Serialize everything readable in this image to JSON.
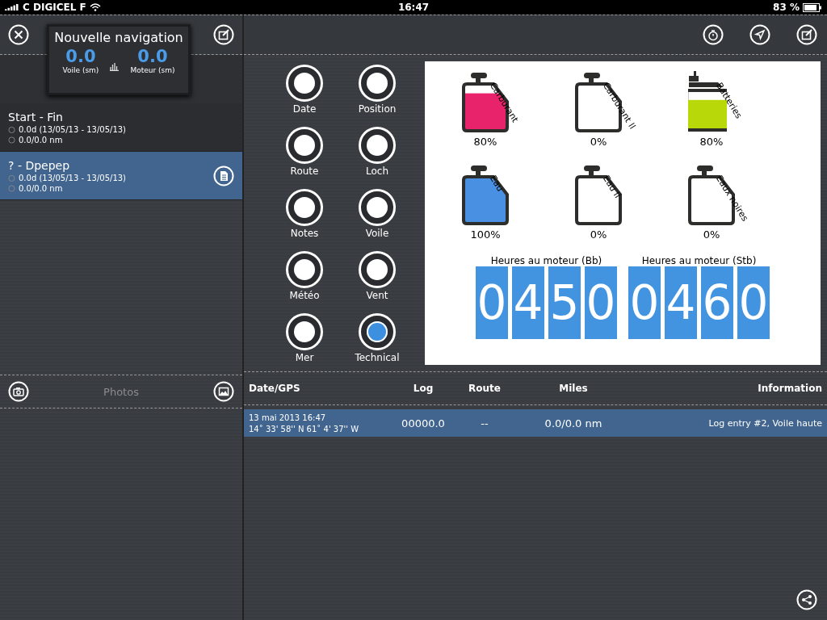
{
  "status_bar": {
    "carrier": "C DIGICEL F",
    "time": "16:47",
    "battery": "83 %"
  },
  "nav_card": {
    "title": "Nouvelle navigation",
    "stats": [
      {
        "value": "0.0",
        "label": "Voile (sm)"
      },
      {
        "value": "0.0",
        "label": "Moteur (sm)"
      }
    ]
  },
  "trips": [
    {
      "title": "Start - Fin",
      "duration": "0.0d (13/05/13 - 13/05/13)",
      "distance": "0.0/0.0 nm",
      "selected": false
    },
    {
      "title": "? - Dpepep",
      "duration": "0.0d (13/05/13 - 13/05/13)",
      "distance": "0.0/0.0 nm",
      "selected": true
    }
  ],
  "photos": {
    "title": "Photos"
  },
  "categories": [
    {
      "label": "Date",
      "selected": false
    },
    {
      "label": "Position",
      "selected": false
    },
    {
      "label": "Route",
      "selected": false
    },
    {
      "label": "Loch",
      "selected": false
    },
    {
      "label": "Notes",
      "selected": false
    },
    {
      "label": "Voile",
      "selected": false
    },
    {
      "label": "Météo",
      "selected": false
    },
    {
      "label": "Vent",
      "selected": false
    },
    {
      "label": "Mer",
      "selected": false
    },
    {
      "label": "Technical",
      "selected": true
    }
  ],
  "tanks": [
    {
      "kind": "tank",
      "label": "Carburant",
      "reading": "80%",
      "level": 0.8,
      "color": "#e8236b"
    },
    {
      "kind": "tank",
      "label": "Carburant II",
      "reading": "0%",
      "level": 0
    },
    {
      "kind": "battery",
      "label": "Batteries",
      "reading": "80%",
      "level": 0.8,
      "color": "#b9d80a"
    },
    {
      "kind": "tank",
      "label": "Eau",
      "reading": "100%",
      "level": 1,
      "color": "#4a90e2"
    },
    {
      "kind": "tank",
      "label": "Eau II",
      "reading": "0%",
      "level": 0
    },
    {
      "kind": "tank",
      "label": "Eaux noires",
      "reading": "0%",
      "level": 0
    }
  ],
  "engine_hours": [
    {
      "label": "Heures au moteur (Bb)",
      "digits": [
        "0",
        "4",
        "5",
        "0"
      ]
    },
    {
      "label": "Heures au moteur (Stb)",
      "digits": [
        "0",
        "4",
        "6",
        "0"
      ]
    }
  ],
  "log": {
    "columns": [
      "Date/GPS",
      "Log",
      "Route",
      "Miles",
      "Information"
    ],
    "rows": [
      {
        "date": "13 mai 2013 16:47",
        "gps": "14˚ 33' 58'' N 61˚ 4' 37'' W",
        "log": "00000.0",
        "route": "--",
        "miles": "0.0/0.0 nm",
        "info": "Log entry #2, Voile haute",
        "selected": true
      }
    ]
  }
}
